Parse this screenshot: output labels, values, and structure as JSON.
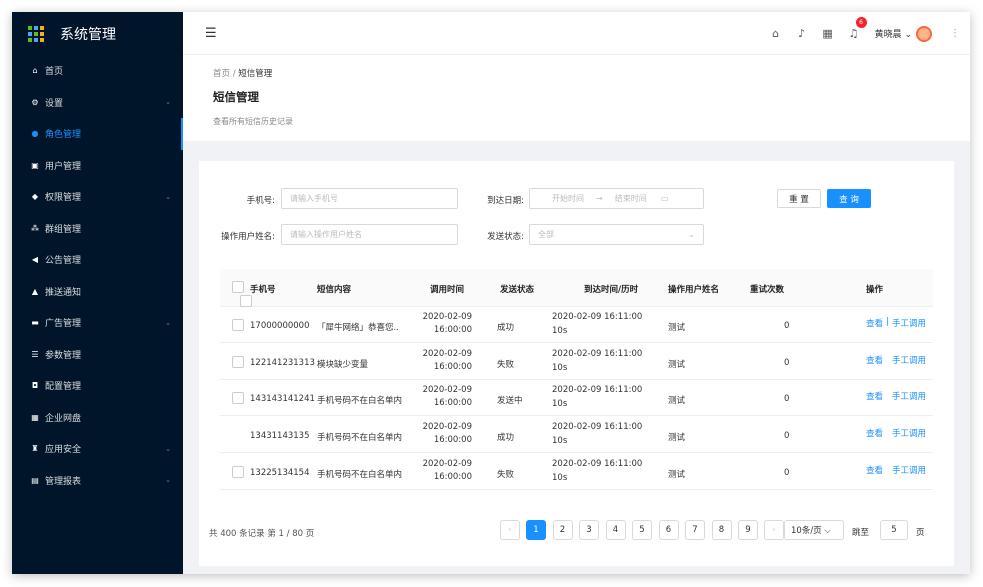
{
  "app": {
    "title": "系统管理"
  },
  "sidebar": {
    "items": [
      {
        "label": "首页",
        "icon": "home-icon",
        "glyph": "⌂",
        "chevron": false
      },
      {
        "label": "设置",
        "icon": "gear-icon",
        "glyph": "⚙",
        "chevron": true
      },
      {
        "label": "角色管理",
        "icon": "role-icon",
        "glyph": "●",
        "chevron": false,
        "active": true
      },
      {
        "label": "用户管理",
        "icon": "user-icon",
        "glyph": "▣",
        "chevron": false
      },
      {
        "label": "权限管理",
        "icon": "shield-icon",
        "glyph": "◆",
        "chevron": true
      },
      {
        "label": "群组管理",
        "icon": "group-icon",
        "glyph": "⁂",
        "chevron": false
      },
      {
        "label": "公告管理",
        "icon": "megaphone-icon",
        "glyph": "◀",
        "chevron": false
      },
      {
        "label": "推送通知",
        "icon": "bell-icon",
        "glyph": "▲",
        "chevron": false
      },
      {
        "label": "广告管理",
        "icon": "ad-icon",
        "glyph": "▬",
        "chevron": true
      },
      {
        "label": "参数管理",
        "icon": "params-icon",
        "glyph": "☰",
        "chevron": false
      },
      {
        "label": "配置管理",
        "icon": "config-icon",
        "glyph": "◘",
        "chevron": false
      },
      {
        "label": "企业网盘",
        "icon": "disk-icon",
        "glyph": "▦",
        "chevron": false
      },
      {
        "label": "应用安全",
        "icon": "security-icon",
        "glyph": "♜",
        "chevron": true
      },
      {
        "label": "管理报表",
        "icon": "report-icon",
        "glyph": "▤",
        "chevron": true
      }
    ]
  },
  "header": {
    "badge_count": "6",
    "username": "黄晓晨 ⌄"
  },
  "page": {
    "breadcrumb_home": "首页",
    "breadcrumb_sep": "/",
    "breadcrumb_current": "短信管理",
    "title": "短信管理",
    "description": "查看所有短信历史记录"
  },
  "filters": {
    "phone_label": "手机号:",
    "phone_placeholder": "请输入手机号",
    "date_label": "到达日期:",
    "date_start": "开始时间",
    "date_sep": "→",
    "date_end": "结束时间",
    "operator_label": "操作用户姓名:",
    "operator_placeholder": "请输入操作用户姓名",
    "status_label": "发送状态:",
    "status_value": "全部",
    "reset_label": "重 置",
    "query_label": "查 询"
  },
  "table": {
    "headers": [
      "手机号",
      "短信内容",
      "调用时间",
      "发送状态",
      "到达时间/历时",
      "操作用户姓名",
      "重试次数",
      "操作"
    ],
    "rows": [
      {
        "phone": "17000000000",
        "content": "「犀牛网络」恭喜您..",
        "time1": "2020-02-09",
        "time2": "16:00:00",
        "status": "成功",
        "arrive1": "2020-02-09 16:11:00",
        "arrive2": "10s",
        "operator": "测试",
        "retries": "0",
        "action1": "查看",
        "sep": "|",
        "action2": "手工调用",
        "checkbox": true
      },
      {
        "phone": "122141231313",
        "content": "模块缺少变量",
        "time1": "2020-02-09",
        "time2": "16:00:00",
        "status": "失败",
        "arrive1": "2020-02-09 16:11:00",
        "arrive2": "10s",
        "operator": "测试",
        "retries": "0",
        "action1": "查看",
        "sep": "",
        "action2": "手工调用",
        "checkbox": true
      },
      {
        "phone": "143143141241",
        "content": "手机号码不在白名单内",
        "time1": "2020-02-09",
        "time2": "16:00:00",
        "status": "发送中",
        "arrive1": "2020-02-09 16:11:00",
        "arrive2": "10s",
        "operator": "测试",
        "retries": "0",
        "action1": "查看",
        "sep": "",
        "action2": "手工调用",
        "checkbox": true
      },
      {
        "phone": "13431143135",
        "content": "手机号码不在白名单内",
        "time1": "2020-02-09",
        "time2": "16:00:00",
        "status": "成功",
        "arrive1": "2020-02-09 16:11:00",
        "arrive2": "10s",
        "operator": "测试",
        "retries": "0",
        "action1": "查看",
        "sep": "",
        "action2": "手工调用",
        "checkbox": false
      },
      {
        "phone": "13225134154",
        "content": "手机号码不在白名单内",
        "time1": "2020-02-09",
        "time2": "16:00:00",
        "status": "失败",
        "arrive1": "2020-02-09 16:11:00",
        "arrive2": "10s",
        "operator": "测试",
        "retries": "0",
        "action1": "查看",
        "sep": "",
        "action2": "手工调用",
        "checkbox": true
      }
    ]
  },
  "pagination": {
    "summary": "共 400 条记录 第 1 / 80 页",
    "prev": "‹",
    "pages": [
      "1",
      "2",
      "3",
      "4",
      "5",
      "6",
      "7",
      "8",
      "9"
    ],
    "next": "›",
    "page_size": "10条/页 ⌵",
    "jump_label": "跳至",
    "jump_value": "5",
    "page_suffix": "页"
  }
}
